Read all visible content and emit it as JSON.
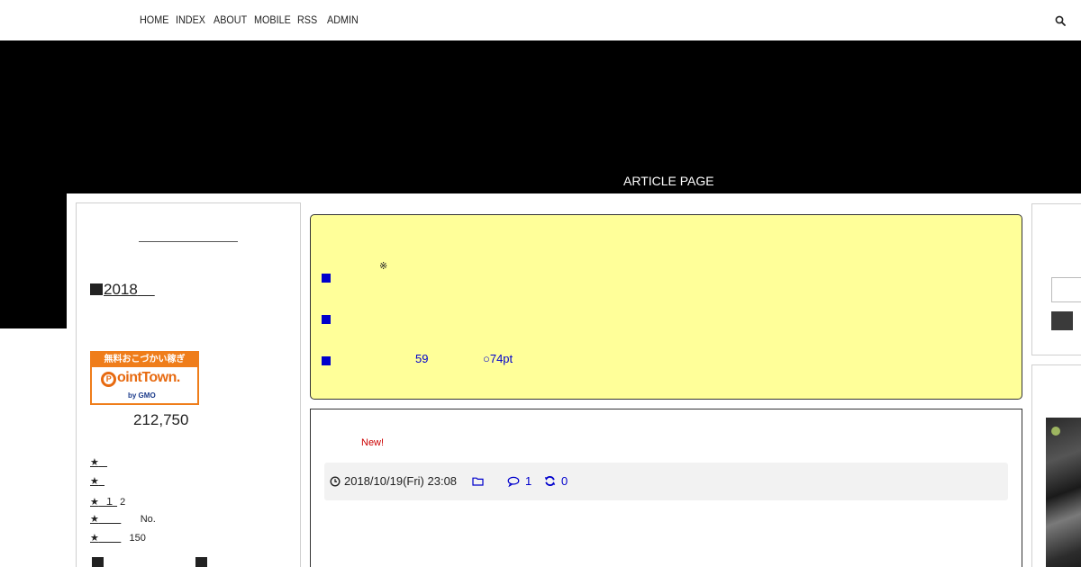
{
  "nav": {
    "items": [
      {
        "label": "HOME"
      },
      {
        "label": "INDEX"
      },
      {
        "label": "ABOUT"
      },
      {
        "label": "MOBILE"
      },
      {
        "label": "RSS"
      },
      {
        "label": "ADMIN"
      }
    ],
    "search_icon": "search-icon"
  },
  "hero": {
    "title": "ARTICLE PAGE",
    "background": "#000000"
  },
  "left_sidebar": {
    "year_heading": "2018",
    "pointtown": {
      "top_text": "無料おこづかい稼ぎ",
      "logo_initial": "P",
      "logo_text": "ointTown.",
      "by_text": "by GMO",
      "accent_color": "#ef7d1a"
    },
    "point_count": "212,750",
    "links": [
      {
        "star": "★",
        "suffix": ""
      },
      {
        "star": "★",
        "suffix": ""
      },
      {
        "star": "★",
        "mid": "１",
        "suffix": "2"
      },
      {
        "star": "★",
        "suffix": "No."
      },
      {
        "star": "★",
        "suffix": "150"
      }
    ]
  },
  "notice": {
    "background": "#ffff99",
    "note_mark": "※",
    "value_count": "59",
    "value_points": "○74pt",
    "bullet_color": "#0000cc"
  },
  "article": {
    "new_label": "New!",
    "date": "2018/10/19(Fri) 23:08",
    "comment_count": "1",
    "trackback_count": "0",
    "icons": {
      "date": "clock-icon",
      "category": "folder-icon",
      "comments": "comment-icon",
      "trackbacks": "refresh-icon"
    }
  }
}
